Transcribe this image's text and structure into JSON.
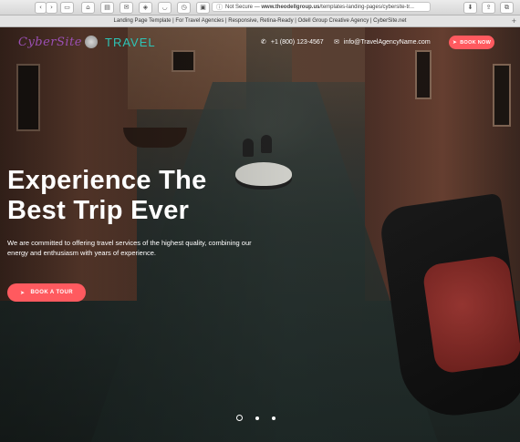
{
  "browser": {
    "url_status": "Not Secure",
    "url_sep": "—",
    "url_host": "www.theodellgroup.us",
    "url_path": "/templates-landing-pages/cybersite-tr...",
    "tab_title": "Landing Page Template | For Travel Agencies | Responsive, Retina-Ready | Odell Group Creative Agency | CyberSite.net",
    "icons": [
      "back-icon",
      "forward-icon",
      "sidebar-icon",
      "home-icon",
      "print-icon",
      "mail-icon",
      "shield-icon",
      "pocket-icon",
      "history-icon",
      "lock-icon",
      "download-icon",
      "info-icon",
      "share-icon",
      "tabs-icon",
      "plus-icon"
    ]
  },
  "header": {
    "logo_cyber": "CyberSite",
    "logo_travel": "TRAVEL",
    "phone": "+1 (800) 123-4567",
    "email": "info@TravelAgencyName.com",
    "book_now": "BOOK NOW"
  },
  "hero": {
    "headline_line1": "Experience The",
    "headline_line2": "Best Trip Ever",
    "subtext": "We are committed to offering travel services of the highest quality, combining our energy and enthusiasm with years of experience.",
    "cta": "BOOK A TOUR",
    "slides_total": 3,
    "slide_active": 1
  },
  "colors": {
    "accent": "#ff5a5f",
    "logo_purple": "#9a4fb3",
    "logo_teal": "#2ec4b6"
  }
}
